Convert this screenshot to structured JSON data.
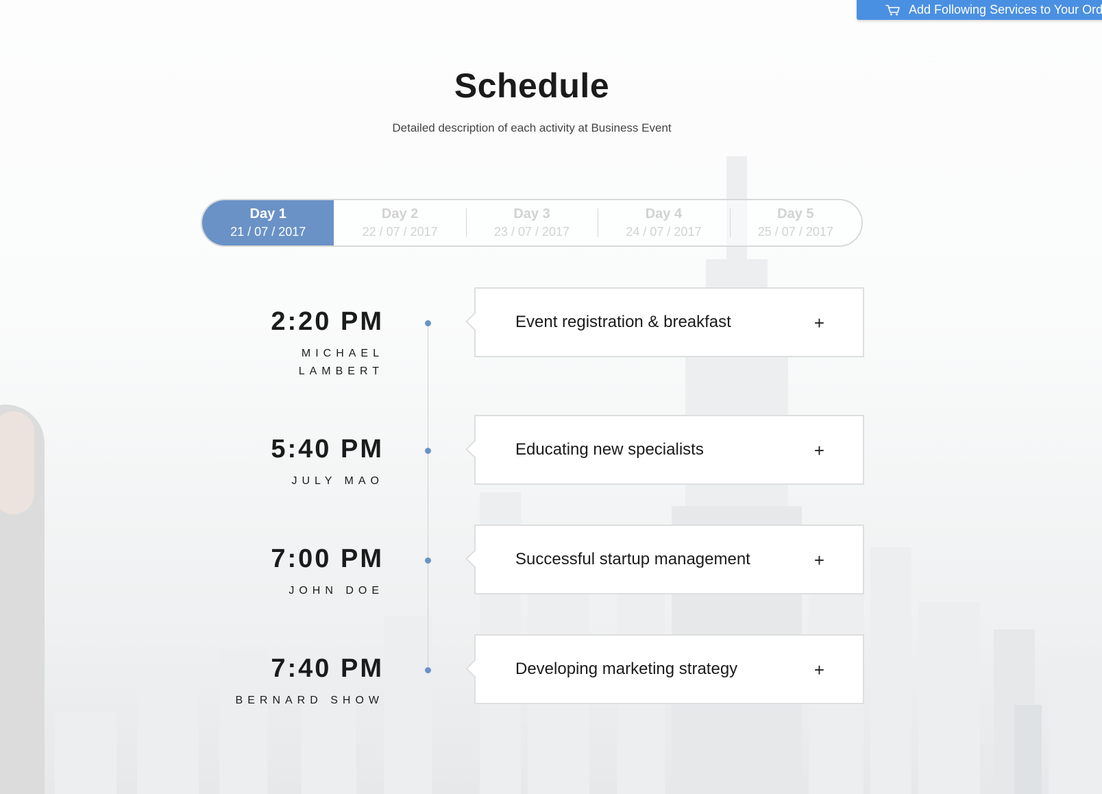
{
  "order_button": {
    "label": "Add Following Services to Your Order",
    "icon": "cart-icon",
    "color": "#4a90e2"
  },
  "header": {
    "title": "Schedule",
    "subtitle": "Detailed description of each activity at Business Event"
  },
  "tabs": [
    {
      "day": "Day 1",
      "date": "21 / 07 / 2017",
      "active": true
    },
    {
      "day": "Day 2",
      "date": "22 / 07 / 2017",
      "active": false
    },
    {
      "day": "Day 3",
      "date": "23 / 07 / 2017",
      "active": false
    },
    {
      "day": "Day 4",
      "date": "24 / 07 / 2017",
      "active": false
    },
    {
      "day": "Day 5",
      "date": "25 / 07 / 2017",
      "active": false
    }
  ],
  "accent_color": "#6a92c6",
  "schedule": [
    {
      "time": "2:20 PM",
      "speaker": "MICHAEL LAMBERT",
      "title": "Event registration & breakfast",
      "expand": "+"
    },
    {
      "time": "5:40 PM",
      "speaker": "JULY MAO",
      "title": "Educating new specialists",
      "expand": "+"
    },
    {
      "time": "7:00 PM",
      "speaker": "JOHN DOE",
      "title": "Successful startup management",
      "expand": "+"
    },
    {
      "time": "7:40 PM",
      "speaker": "BERNARD SHOW",
      "title": "Developing marketing strategy",
      "expand": "+"
    }
  ]
}
